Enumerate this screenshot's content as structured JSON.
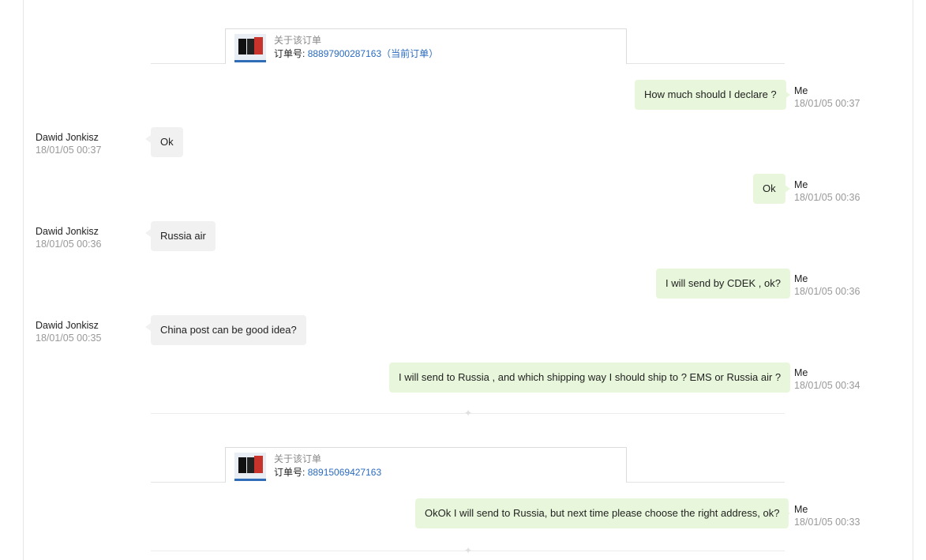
{
  "orders": [
    {
      "about": "关于该订单",
      "label": "订单号:",
      "number": "88897900287163",
      "current": "（当前订单）"
    },
    {
      "about": "关于该订单",
      "label": "订单号:",
      "number": "88915069427163"
    }
  ],
  "messages": [
    {
      "sender": "Me",
      "text": "How much should I declare ?",
      "time": "18/01/05 00:37"
    },
    {
      "sender": "Dawid Jonkisz",
      "text": "Ok",
      "time": "18/01/05 00:37"
    },
    {
      "sender": "Me",
      "text": "Ok",
      "time": "18/01/05 00:36"
    },
    {
      "sender": "Dawid Jonkisz",
      "text": "Russia air",
      "time": "18/01/05 00:36"
    },
    {
      "sender": "Me",
      "text": "I will send by CDEK , ok?",
      "time": "18/01/05 00:36"
    },
    {
      "sender": "Dawid Jonkisz",
      "text": "China post can be good idea?",
      "time": "18/01/05 00:35"
    },
    {
      "sender": "Me",
      "text": "I will send to Russia , and which shipping way I should ship to ? EMS or Russia air ?",
      "time": "18/01/05 00:34"
    },
    {
      "sender": "Me",
      "text": "OkOk I will send to Russia, but next time please choose the right address, ok?",
      "time": "18/01/05 00:33"
    }
  ],
  "colors": {
    "me_bubble": "#e8f7db",
    "them_bubble": "#f1f1f1",
    "link": "#2a6bbf"
  },
  "icons": {
    "divider": "sparkle-icon",
    "product": "phone-thumbnail"
  }
}
